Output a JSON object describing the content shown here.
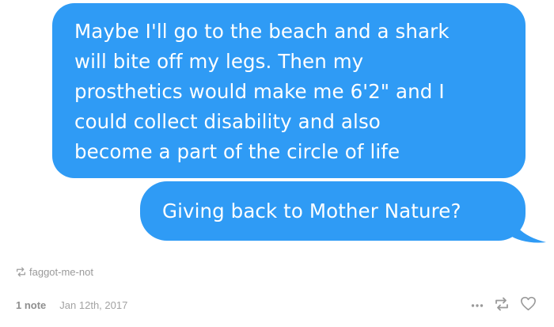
{
  "colors": {
    "bubble": "#2f9bf5",
    "bubble_text": "#ffffff",
    "meta_text": "#9a9a9a"
  },
  "messages": [
    {
      "lines": [
        "Maybe I'll go to the beach and a shark",
        "will bite off my legs. Then my",
        "prosthetics would make me 6'2\" and I",
        "could collect disability and also",
        "become a part of the circle of life"
      ]
    },
    {
      "lines": [
        "Giving back to Mother Nature?"
      ]
    }
  ],
  "reblog": {
    "icon": "reblog-icon",
    "username": "faggot-me-not"
  },
  "footer": {
    "notes": "1 note",
    "date": "Jan 12th, 2017",
    "icons": [
      "more-options-icon",
      "reblog-icon",
      "heart-icon"
    ]
  }
}
